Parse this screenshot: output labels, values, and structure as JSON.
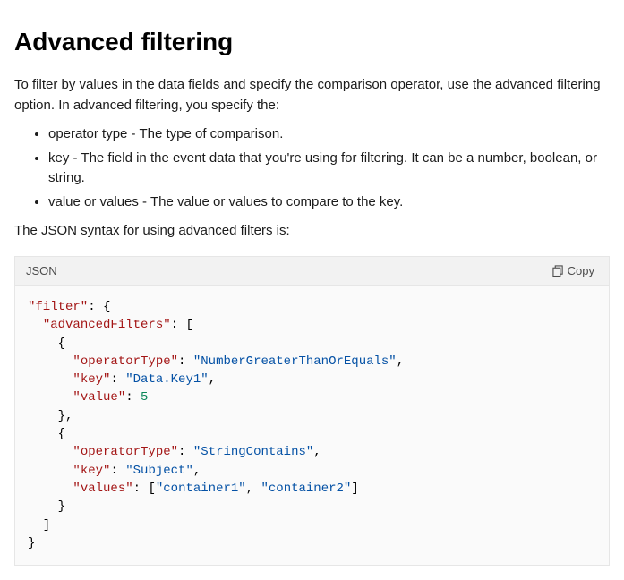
{
  "heading": "Advanced filtering",
  "intro": "To filter by values in the data fields and specify the comparison operator, use the advanced filtering option. In advanced filtering, you specify the:",
  "bullets": [
    "operator type - The type of comparison.",
    "key - The field in the event data that you're using for filtering. It can be a number, boolean, or string.",
    "value or values - The value or values to compare to the key."
  ],
  "syntax_intro": "The JSON syntax for using advanced filters is:",
  "code": {
    "language_label": "JSON",
    "copy_label": "Copy",
    "tokens": [
      [
        "s",
        "\"filter\""
      ],
      [
        null,
        ": {\n  "
      ],
      [
        "s",
        "\"advancedFilters\""
      ],
      [
        null,
        ": [\n    {\n      "
      ],
      [
        "s",
        "\"operatorType\""
      ],
      [
        null,
        ": "
      ],
      [
        "k",
        "\"NumberGreaterThanOrEquals\""
      ],
      [
        null,
        ",\n      "
      ],
      [
        "s",
        "\"key\""
      ],
      [
        null,
        ": "
      ],
      [
        "k",
        "\"Data.Key1\""
      ],
      [
        null,
        ",\n      "
      ],
      [
        "s",
        "\"value\""
      ],
      [
        null,
        ": "
      ],
      [
        "n",
        "5"
      ],
      [
        null,
        "\n    },\n    {\n      "
      ],
      [
        "s",
        "\"operatorType\""
      ],
      [
        null,
        ": "
      ],
      [
        "k",
        "\"StringContains\""
      ],
      [
        null,
        ",\n      "
      ],
      [
        "s",
        "\"key\""
      ],
      [
        null,
        ": "
      ],
      [
        "k",
        "\"Subject\""
      ],
      [
        null,
        ",\n      "
      ],
      [
        "s",
        "\"values\""
      ],
      [
        null,
        ": ["
      ],
      [
        "k",
        "\"container1\""
      ],
      [
        null,
        ", "
      ],
      [
        "k",
        "\"container2\""
      ],
      [
        null,
        "]\n    }\n  ]\n}"
      ]
    ]
  }
}
